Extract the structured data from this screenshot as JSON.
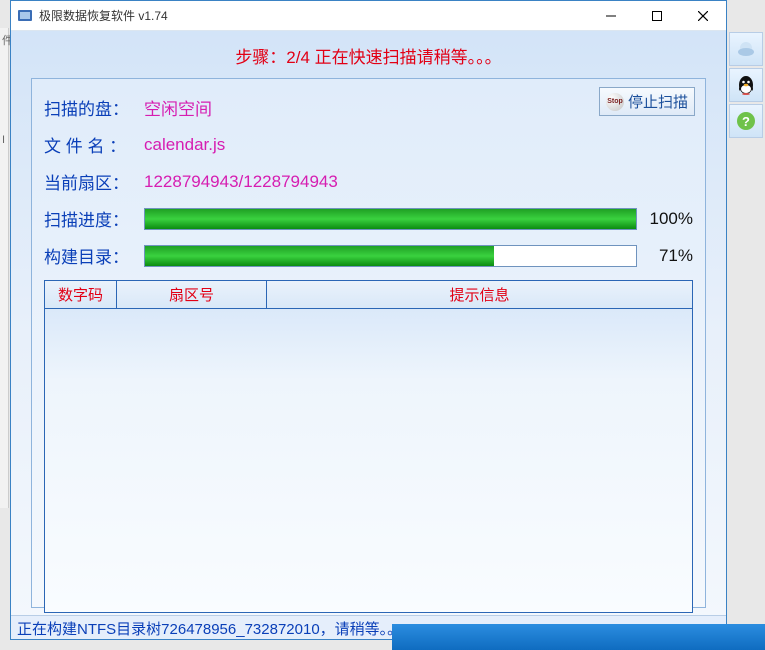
{
  "title": "极限数据恢复软件 v1.74",
  "banner": "步骤：2/4 正在快速扫描请稍等。。。",
  "stop_label": "停止扫描",
  "info": {
    "disk_label": "扫描的盘：",
    "disk_value": "空闲空间",
    "file_label": "文 件 名 ：",
    "file_value": "calendar.js",
    "sector_label": "当前扇区：",
    "sector_value": "1228794943/1228794943"
  },
  "progress": {
    "scan_label": "扫描进度：",
    "scan_pct_text": "100%",
    "scan_pct": 100,
    "build_label": "构建目录：",
    "build_pct_text": "71%",
    "build_pct": 71
  },
  "table": {
    "col1": "数字码",
    "col2": "扇区号",
    "col3": "提示信息"
  },
  "status": "正在构建NTFS目录树726478956_732872010，请稍等。。。",
  "peek_chars": [
    "件",
    "I"
  ]
}
